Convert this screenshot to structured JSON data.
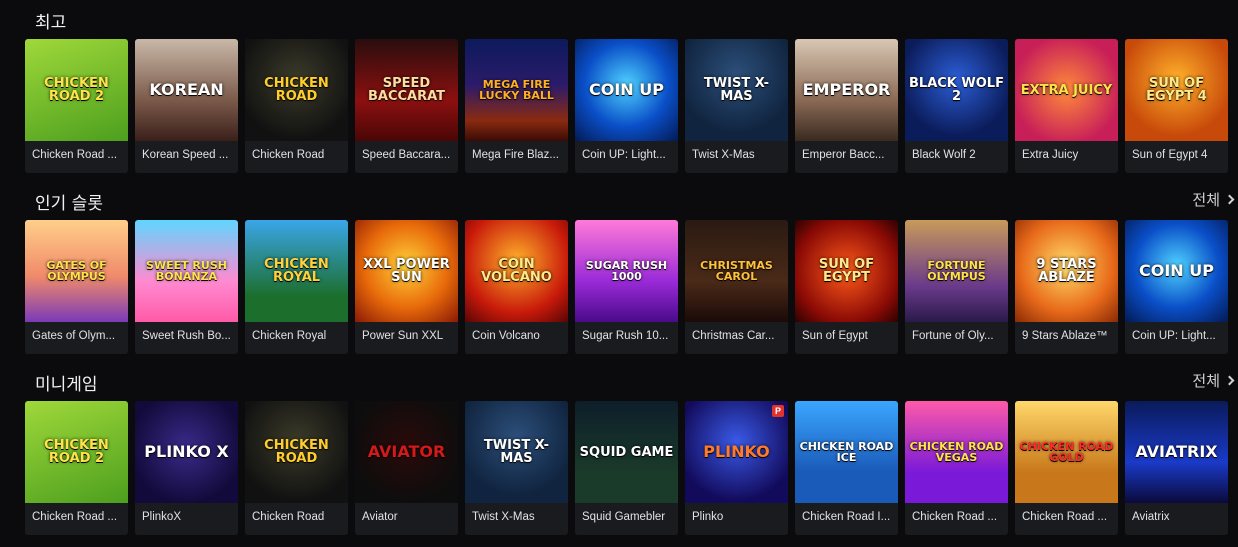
{
  "sections": [
    {
      "title": "최고",
      "view_all": "",
      "games": [
        {
          "label": "Chicken Road ...",
          "art": "CHICKEN ROAD 2",
          "bg": "linear-gradient(160deg,#9fd83a,#4d9f1e)",
          "fg": "#ffe34a"
        },
        {
          "label": "Korean Speed ...",
          "art": "KOREAN",
          "bg": "linear-gradient(180deg,#c9b8a8,#7b5a4a 60%,#3a1f1a)",
          "fg": "#ffffff"
        },
        {
          "label": "Chicken Road",
          "art": "CHICKEN ROAD",
          "bg": "radial-gradient(circle at 50% 40%,#3b3b2a,#111 75%)",
          "fg": "#ffce2e"
        },
        {
          "label": "Speed Baccara...",
          "art": "SPEED BACCARAT",
          "bg": "linear-gradient(180deg,#2a0d0d,#8c1010 60%,#4a0606)",
          "fg": "#ffdca0"
        },
        {
          "label": "Mega Fire Blaz...",
          "art": "MEGA FIRE LUCKY BALL",
          "bg": "linear-gradient(180deg,#0d1a5c,#2b1b6a 45%,#8a2a10 80%,#3a0b05)",
          "fg": "#ffb020"
        },
        {
          "label": "Coin UP: Light...",
          "art": "COIN UP",
          "bg": "radial-gradient(circle at 50% 45%,#4fd2ff,#0a4fc8 55%,#031a55)",
          "fg": "#ffffff"
        },
        {
          "label": "Twist X-Mas",
          "art": "TWIST X-MAS",
          "bg": "radial-gradient(circle at 50% 35%,#2c4f7a,#10243f 70%)",
          "fg": "#ffffff"
        },
        {
          "label": "Emperor Bacc...",
          "art": "EMPEROR",
          "bg": "linear-gradient(180deg,#d8c7b4,#8a6a55 60%,#3a2a20)",
          "fg": "#ffffff"
        },
        {
          "label": "Black Wolf 2",
          "art": "BLACK WOLF 2",
          "bg": "radial-gradient(circle at 50% 40%,#2c5fd8,#0b1c5a 70%)",
          "fg": "#ffffff"
        },
        {
          "label": "Extra Juicy",
          "art": "EXTRA JUICY",
          "bg": "radial-gradient(circle at 50% 50%,#ff8a3a,#c81f58 75%)",
          "fg": "#ffe24a"
        },
        {
          "label": "Sun of Egypt 4",
          "art": "SUN OF EGYPT 4",
          "bg": "radial-gradient(circle at 50% 40%,#ffb02a,#c84a0a 70%)",
          "fg": "#ffe98a"
        }
      ]
    },
    {
      "title": "인기 슬롯",
      "view_all": "전체",
      "games": [
        {
          "label": "Gates of Olym...",
          "art": "GATES OF OLYMPUS",
          "bg": "linear-gradient(180deg,#ffcf8a,#f08a6a 55%,#7a3ab8)",
          "fg": "#ffe14a"
        },
        {
          "label": "Sweet Rush Bo...",
          "art": "SWEET RUSH BONANZA",
          "bg": "linear-gradient(180deg,#5fd6ff,#ff8ad0 60%,#ff5aa8)",
          "fg": "#ffe34a"
        },
        {
          "label": "Chicken Royal",
          "art": "CHICKEN ROYAL",
          "bg": "linear-gradient(180deg,#3aa6e8,#1c6e2c 75%)",
          "fg": "#ffd23a"
        },
        {
          "label": "Power Sun XXL",
          "art": "XXL POWER SUN",
          "bg": "radial-gradient(circle at 50% 45%,#ffd23a,#e86a0a 55%,#8a1a05)",
          "fg": "#ffffff"
        },
        {
          "label": "Coin Volcano",
          "art": "COIN VOLCANO",
          "bg": "radial-gradient(circle at 50% 40%,#ffb02a,#c81a0a 65%,#5a0505)",
          "fg": "#ffe98a"
        },
        {
          "label": "Sugar Rush 10...",
          "art": "SUGAR RUSH 1000",
          "bg": "linear-gradient(180deg,#ff7ad8,#9a2ad8 60%,#4a0a8a)",
          "fg": "#ffffff"
        },
        {
          "label": "Christmas Car...",
          "art": "CHRISTMAS CAROL",
          "bg": "linear-gradient(180deg,#2a1a12,#4a2a18 60%,#1a0a08)",
          "fg": "#ffc23a"
        },
        {
          "label": "Sun of Egypt",
          "art": "SUN OF EGYPT",
          "bg": "radial-gradient(circle at 50% 50%,#ff5a1a,#8a0a05 70%,#2a0202)",
          "fg": "#ffe98a"
        },
        {
          "label": "Fortune of Oly...",
          "art": "FORTUNE OLYMPUS",
          "bg": "linear-gradient(180deg,#c89a5a,#6a3a8a 65%,#2a1a4a)",
          "fg": "#ffe14a"
        },
        {
          "label": "9 Stars Ablaze™",
          "art": "9 STARS ABLAZE",
          "bg": "radial-gradient(circle at 50% 45%,#ffdc6a,#e86a1a 60%,#8a2a05)",
          "fg": "#ffffff"
        },
        {
          "label": "Coin UP: Light...",
          "art": "COIN UP",
          "bg": "radial-gradient(circle at 50% 45%,#4fd2ff,#0a4fc8 55%,#031a55)",
          "fg": "#ffffff"
        }
      ]
    },
    {
      "title": "미니게임",
      "view_all": "전체",
      "games": [
        {
          "label": "Chicken Road ...",
          "art": "CHICKEN ROAD 2",
          "bg": "linear-gradient(160deg,#9fd83a,#4d9f1e)",
          "fg": "#ffe34a"
        },
        {
          "label": "PlinkoX",
          "art": "PLINKO X",
          "bg": "radial-gradient(circle at 50% 45%,#3a2a8a,#120a3a 75%)",
          "fg": "#ffffff"
        },
        {
          "label": "Chicken Road",
          "art": "CHICKEN ROAD",
          "bg": "radial-gradient(circle at 50% 40%,#3b3b2a,#111 75%)",
          "fg": "#ffce2e"
        },
        {
          "label": "Aviator",
          "art": "Aviator",
          "bg": "radial-gradient(circle at 50% 45%,#2a0a0a,#0d0d0d 75%)",
          "fg": "#d21a1a"
        },
        {
          "label": "Twist X-Mas",
          "art": "TWIST X-MAS",
          "bg": "radial-gradient(circle at 50% 35%,#2c4f7a,#10243f 70%)",
          "fg": "#ffffff"
        },
        {
          "label": "Squid Gamebler",
          "art": "SQUID GAME",
          "bg": "linear-gradient(180deg,#0d1e2a,#1a3a2a 70%)",
          "fg": "#ffffff"
        },
        {
          "label": "Plinko",
          "art": "PLINKO",
          "bg": "radial-gradient(circle at 50% 40%,#3a5ae8,#120a5a 75%)",
          "fg": "#ff7a2a",
          "badge": "P"
        },
        {
          "label": "Chicken Road I...",
          "art": "CHICKEN ROAD ICE",
          "bg": "linear-gradient(180deg,#3aa6ff,#1a5ab8 70%)",
          "fg": "#ffffff"
        },
        {
          "label": "Chicken Road ...",
          "art": "CHICKEN ROAD VEGAS",
          "bg": "linear-gradient(180deg,#ff5aa8,#7a1ad8 70%)",
          "fg": "#ffe34a"
        },
        {
          "label": "Chicken Road ...",
          "art": "CHICKEN ROAD GOLD",
          "bg": "linear-gradient(180deg,#ffd86a,#c8781a 70%)",
          "fg": "#ff2a2a"
        },
        {
          "label": "Aviatrix",
          "art": "Aviatrix",
          "bg": "linear-gradient(180deg,#0a1a5a,#1a3ac8 60%,#0a0a3a)",
          "fg": "#ffffff"
        }
      ]
    }
  ]
}
